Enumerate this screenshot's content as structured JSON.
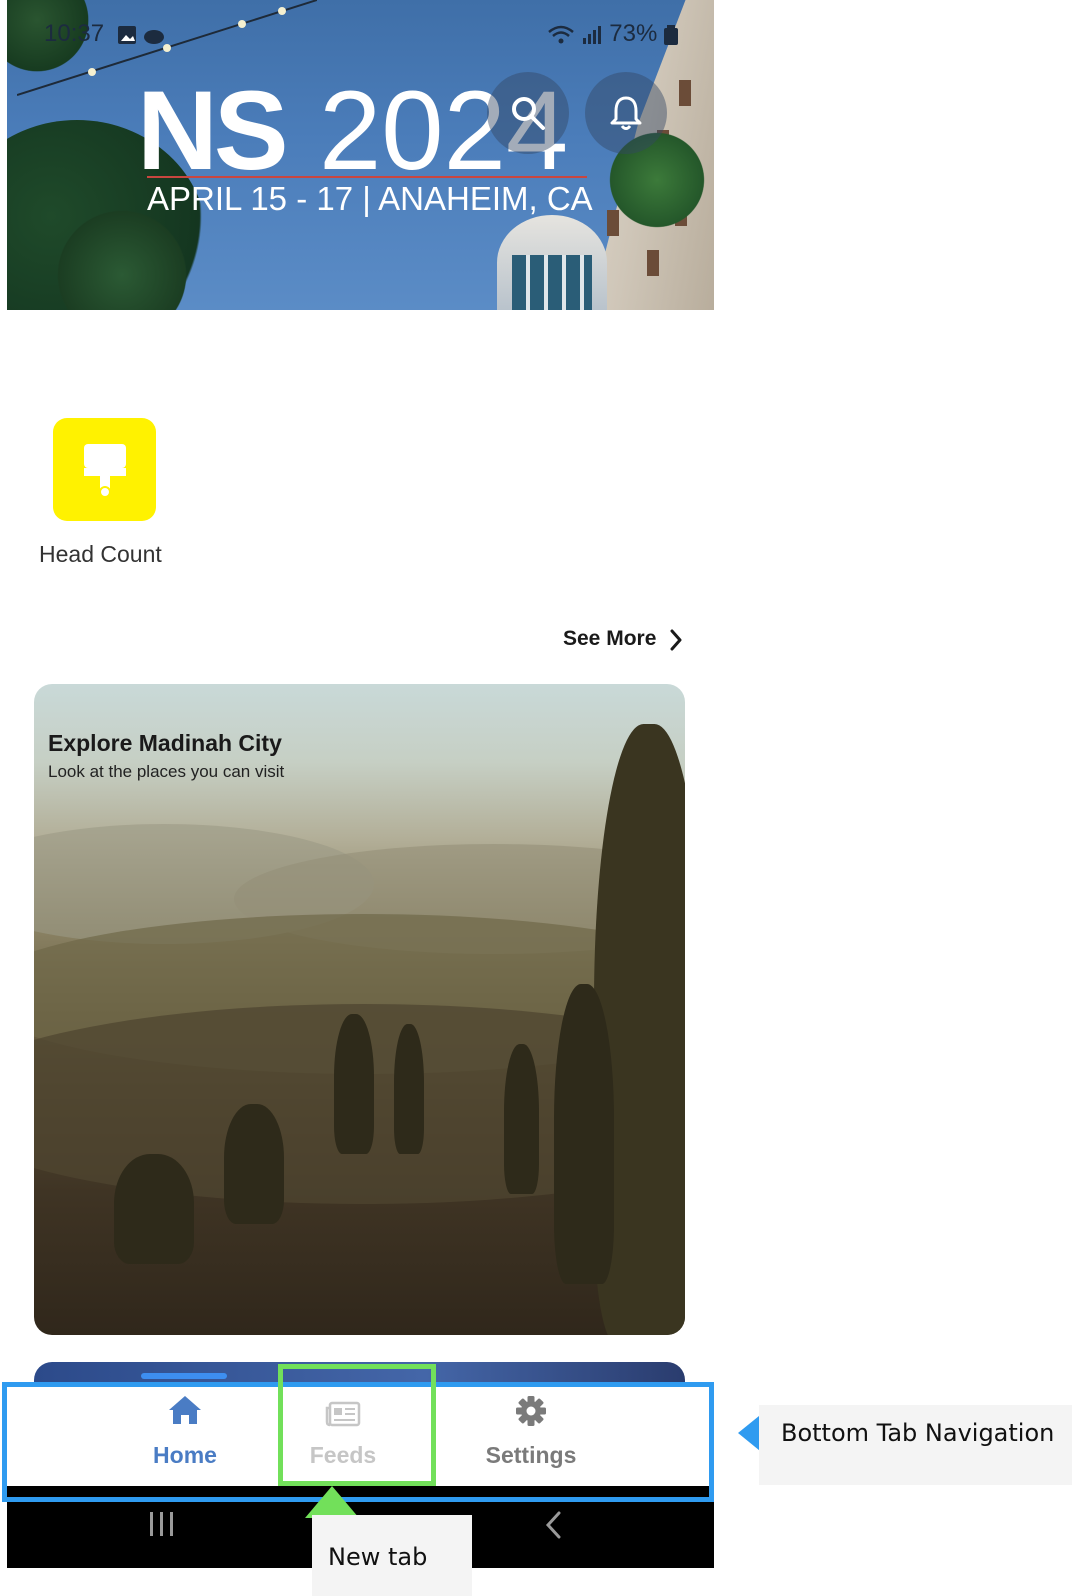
{
  "status_bar": {
    "time": "10:37",
    "battery": "73%"
  },
  "banner": {
    "logo_ns": "NS",
    "logo_year": "2024",
    "event_dates": "APRIL 15 - 17 | ANAHEIM, CA",
    "search_icon": "search-icon",
    "notification_icon": "bell-icon"
  },
  "quick_actions": [
    {
      "label": "Head Count",
      "icon": "paint-roller-icon",
      "color": "#fff200"
    }
  ],
  "see_more": {
    "label": "See More",
    "icon": "chevron-right-icon"
  },
  "featured_card": {
    "title": "Explore Madinah City",
    "subtitle": "Look at the places you can visit"
  },
  "tabbar": {
    "active_color": "#4a7cc4",
    "tabs": [
      {
        "label": "Home",
        "icon": "home-icon",
        "active": true
      },
      {
        "label": "Feeds",
        "icon": "newspaper-icon",
        "active": false
      },
      {
        "label": "Settings",
        "icon": "gear-icon",
        "active": false
      }
    ]
  },
  "annotations": {
    "bottom_nav_label": "Bottom Tab Navigation",
    "new_tab_label": "New tab",
    "bottom_nav_color": "#2f9bf0",
    "new_tab_color": "#72e05a"
  }
}
